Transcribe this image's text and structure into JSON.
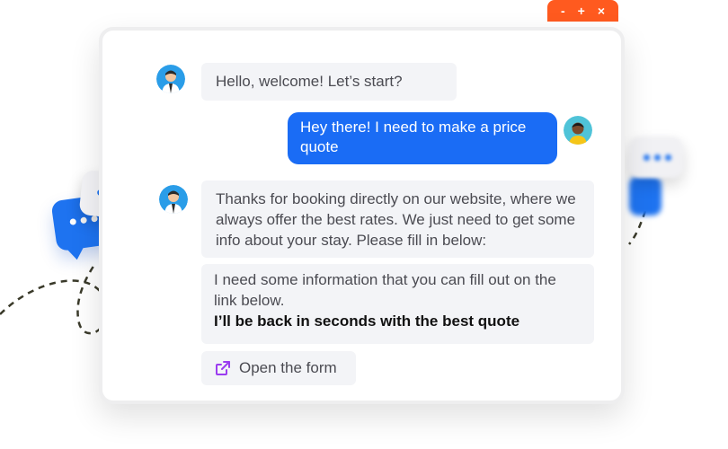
{
  "window_controls": {
    "minimize": "-",
    "maximize": "+",
    "close": "×"
  },
  "messages": [
    {
      "from": "bot",
      "text": "Hello, welcome! Let’s start?"
    },
    {
      "from": "user",
      "text": "Hey there! I need to make a price quote"
    },
    {
      "from": "bot",
      "text": "Thanks for booking directly on our website, where we always offer the best rates. We just need to get some info about your stay. Please fill in below:"
    },
    {
      "from": "bot",
      "text": "I need some information that you can fill out on the link below.",
      "bold": "I’ll be back in seconds with the best quote"
    }
  ],
  "form_link": {
    "label": "Open the form",
    "icon": "external-link-icon"
  },
  "colors": {
    "accent_blue": "#1a6cf5",
    "window_tab_orange": "#ff5a1f",
    "bot_bubble_bg": "#f3f4f7",
    "link_icon_purple": "#9b3cf0"
  }
}
